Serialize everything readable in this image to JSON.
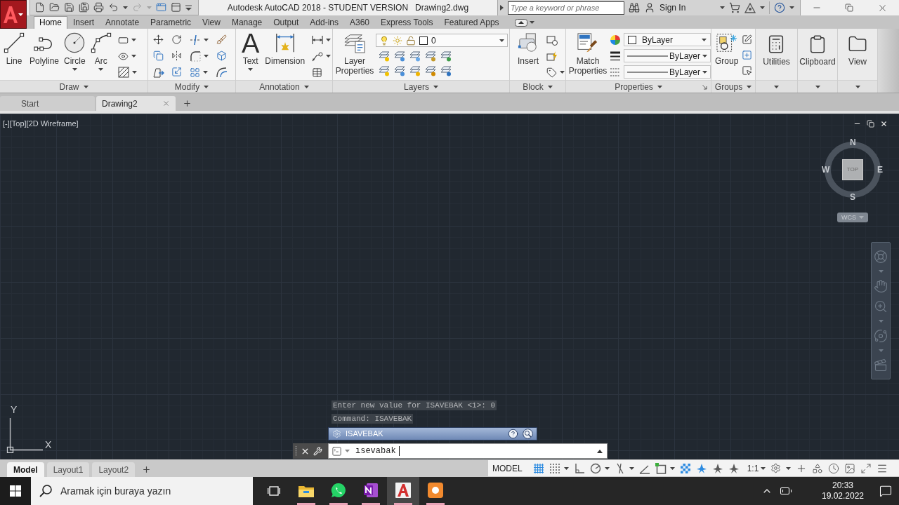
{
  "title_bar": {
    "title": "Autodesk AutoCAD 2018 - STUDENT VERSION",
    "document": "Drawing2.dwg",
    "search": {
      "placeholder": "Type a keyword or phrase"
    },
    "sign_in": "Sign In"
  },
  "quick_access": {
    "redo": {
      "disabled": true
    }
  },
  "ribbon_tabs": [
    {
      "label": "Home",
      "selected": true
    },
    {
      "label": "Insert",
      "selected": false
    },
    {
      "label": "Annotate",
      "selected": false
    },
    {
      "label": "Parametric",
      "selected": false
    },
    {
      "label": "View",
      "selected": false
    },
    {
      "label": "Manage",
      "selected": false
    },
    {
      "label": "Output",
      "selected": false
    },
    {
      "label": "Add-ins",
      "selected": false
    },
    {
      "label": "A360",
      "selected": false
    },
    {
      "label": "Express Tools",
      "selected": false
    },
    {
      "label": "Featured Apps",
      "selected": false
    }
  ],
  "ribbon_panels": [
    {
      "kind": "draw",
      "title": "Draw",
      "tools": [
        {
          "label": "Line",
          "menu": false
        },
        {
          "label": "Polyline",
          "menu": false
        },
        {
          "label": "Circle",
          "menu": true
        },
        {
          "label": "Arc",
          "menu": true
        }
      ]
    },
    {
      "kind": "modify",
      "title": "Modify"
    },
    {
      "kind": "annotation",
      "title": "Annotation",
      "tools": [
        {
          "label": "Text",
          "glyph": "A",
          "menu": true
        },
        {
          "label": "Dimension",
          "menu": false
        }
      ]
    },
    {
      "kind": "layers",
      "title": "Layers",
      "tools": [
        {
          "label": "Layer Properties",
          "menu": false
        }
      ],
      "current_layer": "0"
    },
    {
      "kind": "block",
      "title": "Block",
      "tools": [
        {
          "label": "Insert",
          "menu": false
        }
      ]
    },
    {
      "kind": "properties",
      "title": "Properties",
      "tools": [
        {
          "label": "Match Properties",
          "menu": false
        }
      ],
      "color_mode": "ByLayer",
      "lineweight": "ByLayer",
      "linetype": "ByLayer"
    },
    {
      "kind": "groups",
      "title": "Groups",
      "tools": [
        {
          "label": "Group",
          "menu": false
        }
      ]
    },
    {
      "kind": "utilities",
      "tools": [
        {
          "label": "Utilities",
          "menu": false
        }
      ]
    },
    {
      "kind": "clipboard",
      "tools": [
        {
          "label": "Clipboard",
          "menu": false
        }
      ]
    },
    {
      "kind": "view",
      "tools": [
        {
          "label": "View",
          "menu": false
        }
      ]
    }
  ],
  "file_tabs": [
    {
      "label": "Start",
      "selected": false
    },
    {
      "label": "Drawing2",
      "selected": true
    }
  ],
  "viewport": {
    "label": "[-][Top][2D Wireframe]",
    "viewcube": {
      "north": "N",
      "west": "W",
      "face": "TOP",
      "east": "E",
      "south": "S"
    },
    "ucs_menu": "WCS",
    "ucs_icon": {
      "y": "Y",
      "x": "X"
    }
  },
  "command_line": {
    "history": [
      "Enter new value for ISAVEBAK <1>: 0",
      "Command: ISAVEBAK"
    ],
    "suggestion": "ISAVEBAK",
    "input": "ısevabak"
  },
  "layout_tabs": [
    {
      "label": "Model",
      "selected": true
    },
    {
      "label": "Layout1",
      "selected": false
    },
    {
      "label": "Layout2",
      "selected": false
    }
  ],
  "status_bar": {
    "space": "MODEL",
    "toggles": [
      {
        "kind": "grid",
        "on": true,
        "menu": false
      },
      {
        "kind": "snap",
        "on": false,
        "menu": true
      },
      {
        "kind": "ortho",
        "on": false,
        "menu": false
      },
      {
        "kind": "polar",
        "on": false,
        "menu": true
      },
      {
        "kind": "isometric",
        "on": false,
        "menu": true
      },
      {
        "kind": "tracking",
        "on": false,
        "menu": false
      },
      {
        "kind": "osnap",
        "on": false,
        "menu": true
      },
      {
        "kind": "transparency",
        "on": true,
        "menu": false
      },
      {
        "kind": "annotation",
        "on": true,
        "menu": false
      },
      {
        "kind": "annotation",
        "on": false,
        "menu": false
      },
      {
        "kind": "annotation",
        "on": false,
        "menu": false
      }
    ],
    "scale": "1:1"
  },
  "taskbar": {
    "search": {
      "placeholder": "Aramak için buraya yazın"
    },
    "apps": [
      {
        "kind": "files",
        "selected": false,
        "running": true
      },
      {
        "kind": "messages",
        "selected": false,
        "running": true
      },
      {
        "kind": "notes",
        "selected": false,
        "running": true
      },
      {
        "kind": "cad",
        "selected": true,
        "running": true
      },
      {
        "kind": "recorder",
        "selected": false,
        "running": true
      }
    ],
    "time": "20:33",
    "date": "19.02.2022"
  }
}
